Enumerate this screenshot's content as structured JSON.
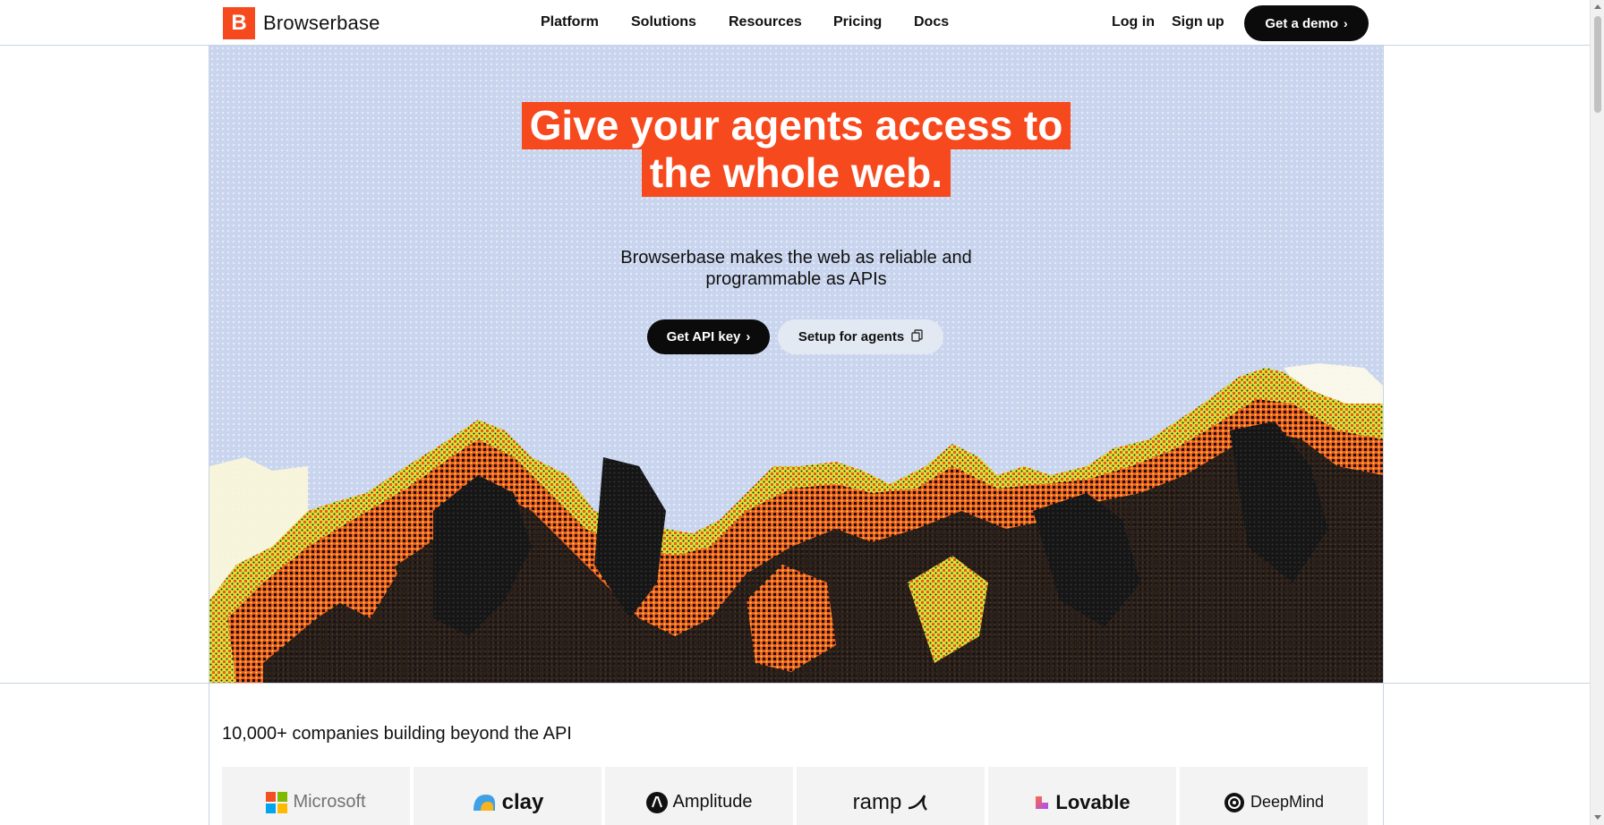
{
  "header": {
    "logo_letter": "B",
    "logo_text": "Browserbase",
    "nav": [
      "Platform",
      "Solutions",
      "Resources",
      "Pricing",
      "Docs"
    ],
    "login": "Log in",
    "signup": "Sign up",
    "demo": "Get a demo",
    "demo_chevron": "›"
  },
  "hero": {
    "headline_line1": "Give your agents access to",
    "headline_line2": "the whole web.",
    "subtitle_line1": "Browserbase makes the web as reliable and",
    "subtitle_line2": "programmable as APIs",
    "cta_primary": "Get API key",
    "cta_primary_chevron": "›",
    "cta_secondary": "Setup for agents",
    "cta_secondary_icon": "copy-icon"
  },
  "companies": {
    "title": "10,000+ companies building beyond the API",
    "logos": [
      "Microsoft",
      "clay",
      "Amplitude",
      "ramp",
      "Lovable",
      "DeepMind"
    ]
  },
  "colors": {
    "accent": "#f7491e",
    "dark": "#0b0b0b",
    "hero_bg": "#c9d5ee",
    "border": "#c9d3e1"
  }
}
